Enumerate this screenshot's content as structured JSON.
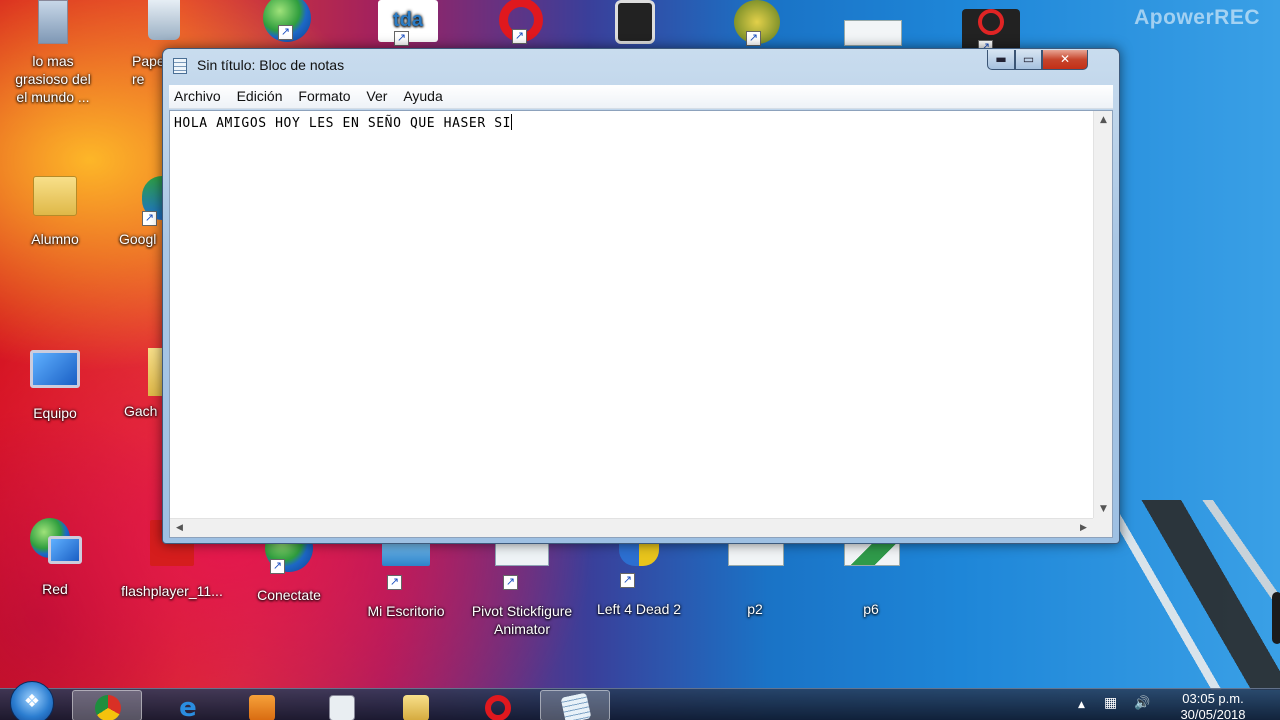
{
  "watermark": "ApowerREC",
  "desktop": {
    "icons": [
      {
        "label": "lo mas grasioso del el mundo ..."
      },
      {
        "label": "Pape re"
      },
      {
        "label": "Alumno"
      },
      {
        "label": "Googl"
      },
      {
        "label": "Equipo"
      },
      {
        "label": "Gach"
      },
      {
        "label": "Red"
      },
      {
        "label": "flashplayer_11..."
      },
      {
        "label": "Conectate"
      },
      {
        "label": "Mi Escritorio"
      },
      {
        "label": "Pivot Stickfigure Animator"
      },
      {
        "label": "Left 4 Dead 2"
      },
      {
        "label": "p2"
      },
      {
        "label": "p6"
      }
    ]
  },
  "window": {
    "title": "Sin título: Bloc de notas",
    "controls": {
      "minimize": "▬",
      "maximize": "▭",
      "close": "✕"
    },
    "menu": [
      "Archivo",
      "Edición",
      "Formato",
      "Ver",
      "Ayuda"
    ],
    "content": "HOLA AMIGOS HOY LES EN SEÑO QUE HASER SI"
  },
  "taskbar": {
    "start_glyph": "❖",
    "clock_time": "03:05 p.m.",
    "clock_date": "30/05/2018",
    "tray_arrow": "▲",
    "volume_glyph": "🔊",
    "network_glyph": "▦"
  },
  "colors": {
    "accent": "#1e86d8",
    "close_red": "#c32f17"
  }
}
